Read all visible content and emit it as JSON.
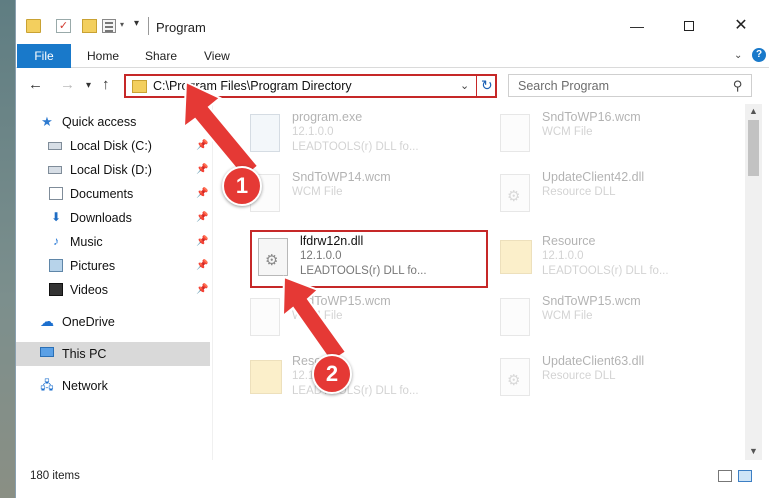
{
  "window": {
    "title": "Program"
  },
  "ribbon": {
    "tabs": [
      "File",
      "Home",
      "Share",
      "View"
    ]
  },
  "nav": {
    "address": "C:\\Program Files\\Program Directory",
    "search_placeholder": "Search Program"
  },
  "sidebar": {
    "items": [
      {
        "label": "Quick access",
        "icon": "star-icon",
        "pinned": false
      },
      {
        "label": "Local Disk (C:)",
        "icon": "drive-icon",
        "pinned": true
      },
      {
        "label": "Local Disk (D:)",
        "icon": "drive-icon",
        "pinned": true
      },
      {
        "label": "Documents",
        "icon": "documents-icon",
        "pinned": true
      },
      {
        "label": "Downloads",
        "icon": "downloads-icon",
        "pinned": true
      },
      {
        "label": "Music",
        "icon": "music-icon",
        "pinned": true
      },
      {
        "label": "Pictures",
        "icon": "pictures-icon",
        "pinned": true
      },
      {
        "label": "Videos",
        "icon": "videos-icon",
        "pinned": true
      },
      {
        "label": "OneDrive",
        "icon": "onedrive-icon",
        "pinned": false
      },
      {
        "label": "This PC",
        "icon": "computer-icon",
        "pinned": false,
        "selected": true
      },
      {
        "label": "Network",
        "icon": "network-icon",
        "pinned": false
      }
    ]
  },
  "files": [
    {
      "name": "program.exe",
      "line2": "12.1.0.0",
      "line3": "LEADTOOLS(r) DLL fo...",
      "icon": "exe-icon"
    },
    {
      "name": "SndToWP16.wcm",
      "line2": "WCM File",
      "line3": "",
      "icon": "file-icon"
    },
    {
      "name": "SndToWP14.wcm",
      "line2": "WCM File",
      "line3": "",
      "icon": "file-icon"
    },
    {
      "name": "UpdateClient42.dll",
      "line2": "Resource DLL",
      "line3": "",
      "icon": "dll-icon"
    },
    {
      "name": "lfdrw12n.dll",
      "line2": "12.1.0.0",
      "line3": "LEADTOOLS(r) DLL fo...",
      "icon": "dll-icon",
      "highlighted": true
    },
    {
      "name": "Resource",
      "line2": "12.1.0.0",
      "line3": "LEADTOOLS(r) DLL fo...",
      "icon": "folder-icon"
    },
    {
      "name": "SndToWP15.wcm",
      "line2": "WCM File",
      "line3": "",
      "icon": "file-icon"
    },
    {
      "name": "SndToWP15.wcm",
      "line2": "WCM File",
      "line3": "",
      "icon": "file-icon"
    },
    {
      "name": "Resource",
      "line2": "12.1.0.0",
      "line3": "LEADTOOLS(r) DLL fo...",
      "icon": "folder-icon"
    },
    {
      "name": "UpdateClient63.dll",
      "line2": "Resource DLL",
      "line3": "",
      "icon": "dll-icon"
    }
  ],
  "status": {
    "item_count": "180 items"
  },
  "callouts": [
    "1",
    "2"
  ],
  "colors": {
    "accent": "#1979ca",
    "highlight_border": "#c62828",
    "callout": "#e53935"
  }
}
